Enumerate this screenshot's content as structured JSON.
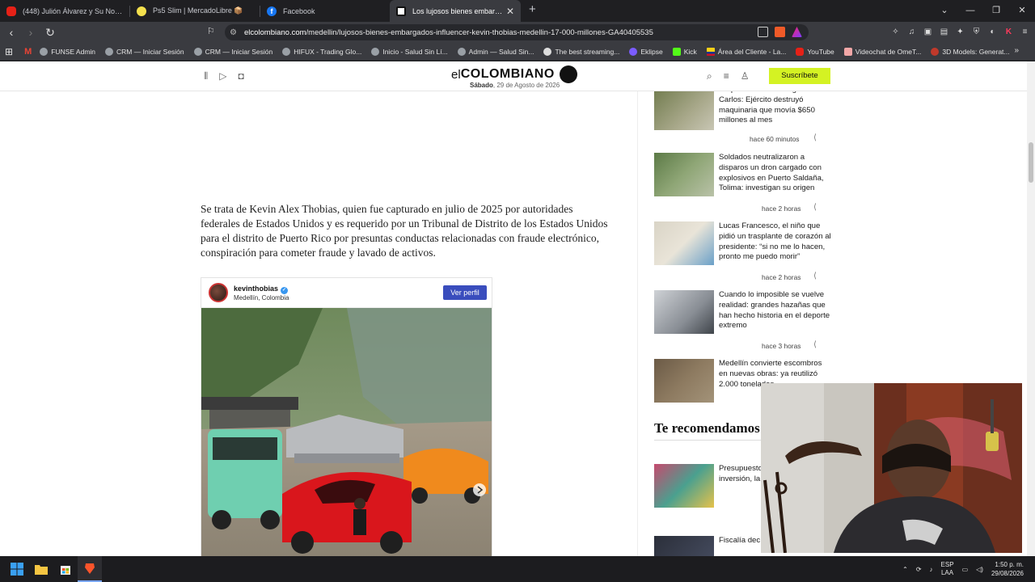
{
  "browser": {
    "tabs": [
      {
        "title": "(448) Julión Álvarez y Su Norteño Banda",
        "favicon": "youtube-icon",
        "color": "#e62117"
      },
      {
        "title": "Ps5 Slim | MercadoLibre 📦",
        "favicon": "mercadolibre-icon",
        "color": "#f4e04d"
      },
      {
        "title": "Facebook",
        "favicon": "facebook-icon",
        "color": "#1877f2"
      },
      {
        "title": "Los lujosos bienes embargados a",
        "favicon": "elcolombiano-icon",
        "color": "#ffffff",
        "active": true
      }
    ],
    "url_host": "elcolombiano.com",
    "url_path": "/medellin/lujosos-bienes-embargados-influencer-kevin-thobias-medellin-17-000-millones-GA40405535",
    "bookmarks": [
      {
        "label": "",
        "icon": "apps-grid-icon"
      },
      {
        "label": "",
        "icon": "gmail-icon"
      },
      {
        "label": "FUNSE Admin",
        "icon": "globe-icon"
      },
      {
        "label": "CRM — Iniciar Sesión",
        "icon": "globe-icon"
      },
      {
        "label": "CRM — Iniciar Sesión",
        "icon": "globe-icon"
      },
      {
        "label": "HIFUX - Trading Glo...",
        "icon": "globe-icon"
      },
      {
        "label": "Inicio - Salud Sin Lí...",
        "icon": "globe-icon"
      },
      {
        "label": "Admin — Salud Sin...",
        "icon": "globe-icon"
      },
      {
        "label": "The best streaming...",
        "icon": "streaming-icon"
      },
      {
        "label": "Eklipse",
        "icon": "eklipse-icon"
      },
      {
        "label": "Kick",
        "icon": "kick-icon"
      },
      {
        "label": "Área del Cliente - La...",
        "icon": "flag-icon"
      },
      {
        "label": "YouTube",
        "icon": "youtube-icon"
      },
      {
        "label": "Videochat de OmeT...",
        "icon": "video-icon"
      },
      {
        "label": "3D Models: Generat...",
        "icon": "3d-icon"
      }
    ]
  },
  "site": {
    "logo_el": "el",
    "logo_main": "COLOMBIANO",
    "date_day": "Sábado",
    "date_rest": ", 29 de Agosto de 2026",
    "subscribe": "Suscríbete"
  },
  "article": {
    "paragraph": "Se trata de Kevin Alex Thobias, quien fue capturado en julio de 2025 por autoridades federales de Estados Unidos y es requerido por un Tribunal de Distrito de los Estados Unidos para el distrito de Puerto Rico por presuntas conductas relacionadas con fraude electrónico, conspiración para cometer fraude y lavado de activos."
  },
  "instagram": {
    "user": "kevinthobias",
    "location": "Medellín, Colombia",
    "button": "Ver perfil"
  },
  "sidebar": {
    "news": [
      {
        "headline": "Golpe a la minería ilegal en San Carlos: Ejército destruyó maquinaria que movía $650 millones al mes",
        "time": "hace 60 minutos"
      },
      {
        "headline": "Soldados neutralizaron a disparos un dron cargado con explosivos en Puerto Saldaña, Tolima: investigan su origen",
        "time": "hace 2 horas"
      },
      {
        "headline": "Lucas Francesco, el niño que pidió un trasplante de corazón al presidente: “si no me lo hacen, pronto me puedo morir”",
        "time": "hace 2 horas"
      },
      {
        "headline": "Cuando lo imposible se vuelve realidad: grandes hazañas que han hecho historia en el deporte extremo",
        "time": "hace 3 horas"
      },
      {
        "headline": "Medellín convierte escombros en nuevas obras: ya reutilizó 2.000 toneladas",
        "time": ""
      }
    ],
    "recommend_title": "Te recomendamos",
    "recommend": [
      {
        "headline": "Presupuesto récord, más inversión, la... expertos"
      },
      {
        "headline": "Fiscalía dec... investigació..."
      }
    ]
  },
  "taskbar": {
    "lang_top": "ESP",
    "lang_bottom": "LAA",
    "time": "1:50 p. m.",
    "date": "29/08/2026"
  }
}
